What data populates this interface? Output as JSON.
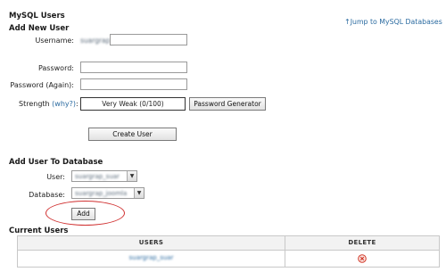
{
  "header": {
    "title": "MySQL Users",
    "jump_link": "Jump to MySQL Databases",
    "jump_icon": "up-arrow-icon"
  },
  "add_user": {
    "section_title": "Add New User",
    "username_label": "Username:",
    "username_value": "suargrap_",
    "password_label": "Password:",
    "password_value": "",
    "password_again_label": "Password (Again):",
    "password_again_value": "",
    "strength_label": "Strength",
    "strength_why": "(why?)",
    "strength_colon": ":",
    "strength_value": "Very Weak (0/100)",
    "password_generator_label": "Password Generator",
    "create_user_label": "Create User"
  },
  "add_to_db": {
    "section_title": "Add User To Database",
    "user_label": "User:",
    "user_value": "suargrap_suar",
    "database_label": "Database:",
    "database_value": "suargrap_joomla",
    "add_label": "Add",
    "highlight_color": "#d03030"
  },
  "current_users": {
    "section_title": "Current Users",
    "columns": [
      "USERS",
      "DELETE"
    ],
    "rows": [
      {
        "user": "suargrap_suar",
        "delete_icon": "delete-x-icon"
      }
    ]
  },
  "colors": {
    "link": "#2a6aa0",
    "delete_icon": "#d23a2a"
  }
}
